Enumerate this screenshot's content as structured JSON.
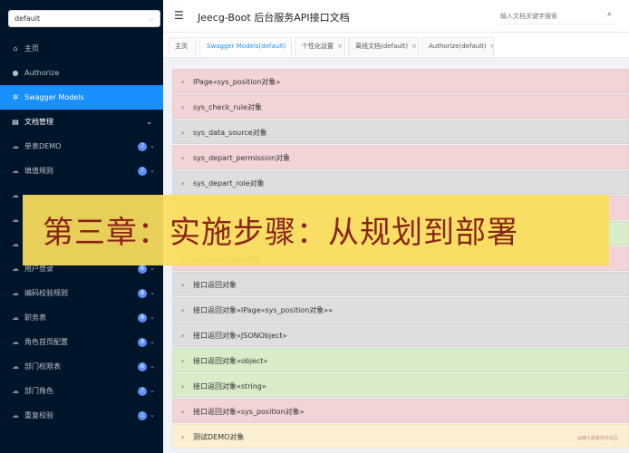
{
  "sidebar": {
    "group_select": "default",
    "items": [
      {
        "label": "主页",
        "icon": "home-icon",
        "glyph": "⌂"
      },
      {
        "label": "Authorize",
        "icon": "user-icon",
        "glyph": "●"
      },
      {
        "label": "Swagger Models",
        "icon": "cube-icon",
        "glyph": "✲"
      },
      {
        "label": "文档管理",
        "icon": "document-icon",
        "glyph": "▤"
      }
    ],
    "sub_items": [
      {
        "label": "单表DEMO",
        "count": "7"
      },
      {
        "label": "填值规则",
        "count": "7"
      },
      {
        "label": "",
        "count": ""
      },
      {
        "label": "",
        "count": ""
      },
      {
        "label": "",
        "count": ""
      },
      {
        "label": "用户登录",
        "count": "6"
      },
      {
        "label": "编码校验规则",
        "count": "8"
      },
      {
        "label": "职务表",
        "count": "8"
      },
      {
        "label": "角色首页配置",
        "count": "8"
      },
      {
        "label": "部门权限表",
        "count": "6"
      },
      {
        "label": "部门角色",
        "count": "7"
      },
      {
        "label": "重复校验",
        "count": "1"
      }
    ]
  },
  "header": {
    "title": "Jeecg-Boot 后台服务API接口文档",
    "search_placeholder": "输入文档关键字搜索"
  },
  "tabs": [
    {
      "label": "主页",
      "closable": false
    },
    {
      "label": "Swagger Models(default)",
      "closable": true
    },
    {
      "label": "个性化设置",
      "closable": true
    },
    {
      "label": "离线文档(default)",
      "closable": true
    },
    {
      "label": "Authorize(default)",
      "closable": true
    }
  ],
  "models": [
    {
      "label": "IPage«sys_position对象»",
      "color": "#f2d4d6"
    },
    {
      "label": "sys_check_rule对象",
      "color": "#f2d4d6"
    },
    {
      "label": "sys_data_source对象",
      "color": "#dedede"
    },
    {
      "label": "sys_depart_permission对象",
      "color": "#f2d4d6"
    },
    {
      "label": "sys_depart_role对象",
      "color": "#dedede"
    },
    {
      "label": "",
      "color": "#f2d4d6"
    },
    {
      "label": "",
      "color": "#d8ecc9"
    },
    {
      "label": "sys_role_index对象",
      "color": "#f2d4d6"
    },
    {
      "label": "接口返回对象",
      "color": "#dedede"
    },
    {
      "label": "接口返回对象«IPage«sys_position对象»»",
      "color": "#dedede"
    },
    {
      "label": "接口返回对象«JSONObject»",
      "color": "#dedede"
    },
    {
      "label": "接口返回对象«object»",
      "color": "#d8ecc9"
    },
    {
      "label": "接口返回对象«string»",
      "color": "#d8ecc9"
    },
    {
      "label": "接口返回对象«sys_position对象»",
      "color": "#f2d4d6"
    },
    {
      "label": "测试DEMO对象",
      "color": "#fbefd3"
    }
  ],
  "banner": {
    "text": "第三章：实施步骤：从规划到部署"
  },
  "watermark": "@稀土掘金技术社区"
}
